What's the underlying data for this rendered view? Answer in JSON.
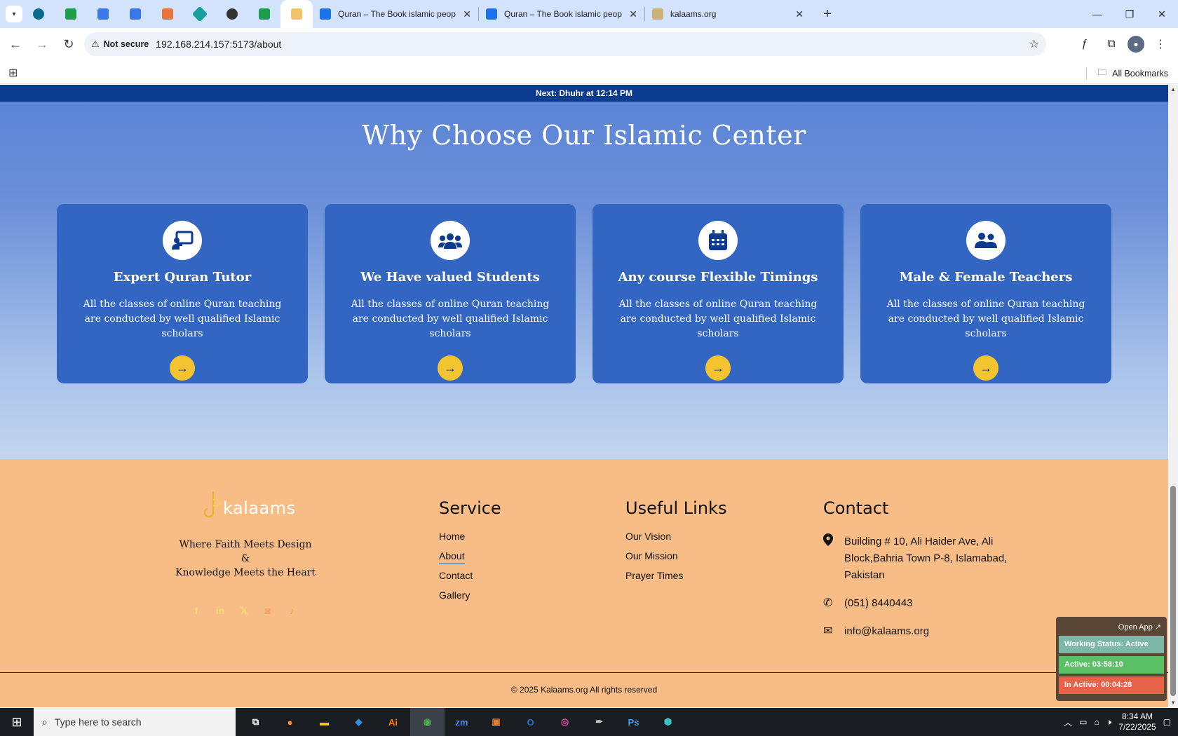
{
  "browser": {
    "tabs": [
      {
        "title": "Quran – The Book islamic peop"
      },
      {
        "title": "Quran – The Book islamic peop"
      },
      {
        "title": "kalaams.org"
      }
    ],
    "address": {
      "security_label": "Not secure",
      "url": "192.168.214.157:5173/about"
    },
    "bookmarks_label": "All Bookmarks"
  },
  "prayer_bar": {
    "prefix": "Next:",
    "prayer": "Dhuhr",
    "suffix": "at 12:14 PM"
  },
  "why": {
    "title": "Why Choose Our Islamic Center",
    "cards": [
      {
        "icon": "chalkboard-teacher-icon",
        "title": "Expert Quran Tutor",
        "text": "All the classes of online Quran teaching are conducted by well qualified Islamic scholars",
        "button": "→"
      },
      {
        "icon": "users-icon",
        "title": "We Have valued Students",
        "text": "All the classes of online Quran teaching are conducted by well qualified Islamic scholars",
        "button": "→"
      },
      {
        "icon": "calendar-icon",
        "title": "Any course Flexible Timings",
        "text": "All the classes of online Quran teaching are conducted by well qualified Islamic scholars",
        "button": "→"
      },
      {
        "icon": "user-friends-icon",
        "title": "Male & Female Teachers",
        "text": "All the classes of online Quran teaching are conducted by well qualified Islamic scholars",
        "button": "→"
      }
    ]
  },
  "footer": {
    "brand": "kalaams",
    "tagline": {
      "line1": "Where Faith Meets Design",
      "line2": "&",
      "line3": "Knowledge Meets the Heart"
    },
    "social": [
      "facebook-icon",
      "linkedin-icon",
      "x-icon",
      "instagram-icon",
      "tiktok-icon"
    ],
    "service": {
      "heading": "Service",
      "items": [
        "Home",
        "About",
        "Contact",
        "Gallery"
      ],
      "active": "About"
    },
    "useful_links": {
      "heading": "Useful Links",
      "items": [
        "Our Vision",
        "Our Mission",
        "Prayer Times"
      ]
    },
    "contact": {
      "heading": "Contact",
      "address": "Building # 10, Ali Haider Ave, Ali Block,Bahria Town P-8, Islamabad, Pakistan",
      "phone": "(051) 8440443",
      "email": "info@kalaams.org"
    },
    "copyright": "© 2025 Kalaams.org All rights reserved"
  },
  "widget": {
    "open_label": "Open App ↗",
    "status": "Working Status: Active",
    "active": "Active: 03:58:10",
    "inactive": "In Active: 00:04:28"
  },
  "taskbar": {
    "search_placeholder": "Type here to search",
    "time": "8:34 AM",
    "date": "7/22/2025"
  },
  "colors": {
    "prayer_bar": "#0b3b8f",
    "card": "#3366c2",
    "accent_button": "#f4c430",
    "footer": "#f8bd87"
  }
}
